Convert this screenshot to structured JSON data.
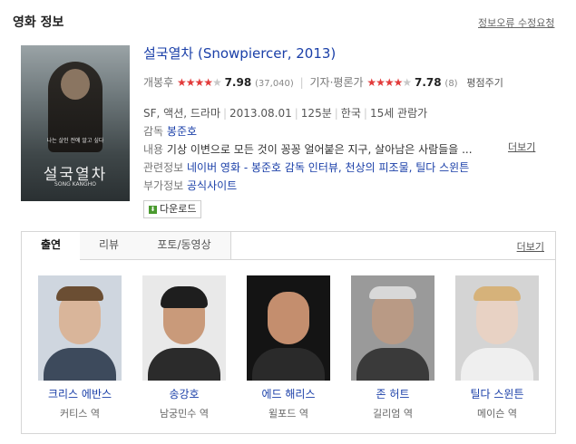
{
  "header": {
    "title": "영화 정보",
    "report_link": "정보오류 수정요청"
  },
  "poster": {
    "tagline": "나는 살인 전에 알고 싶다",
    "title": "설국열차",
    "subtitle": "SONG KANGHO"
  },
  "movie": {
    "title": "설국열차 (Snowpiercer, 2013)",
    "audience": {
      "label": "개봉후",
      "stars_filled": 4,
      "stars_total": 5,
      "score": "7.98",
      "count": "(37,040)"
    },
    "critic": {
      "label": "기자·평론가",
      "stars_filled": 4,
      "stars_total": 5,
      "score": "7.78",
      "count": "(8)",
      "link": "평점주기"
    },
    "meta": {
      "genre": "SF, 액션, 드라마",
      "date": "2013.08.01",
      "runtime": "125분",
      "country": "한국",
      "rating": "15세 관람가"
    },
    "director": {
      "label": "감독",
      "name": "봉준호"
    },
    "synopsis": {
      "label": "내용",
      "text": "기상 이변으로 모든 것이 꽁꽁 얼어붙은 지구, 살아남은 사람들을 ...",
      "more": "더보기"
    },
    "related": {
      "label": "관련정보",
      "text": "네이버 영화 - 봉준호 감독 인터뷰, 천상의 피조물, 틸다 스윈튼"
    },
    "extra": {
      "label": "부가정보",
      "text": "공식사이트"
    },
    "download": "다운로드"
  },
  "tabs": [
    "출연",
    "리뷰",
    "포토/동영상"
  ],
  "tabs_more": "더보기",
  "cast": [
    {
      "name": "크리스 에반스",
      "role": "커티스 역"
    },
    {
      "name": "송강호",
      "role": "남궁민수 역"
    },
    {
      "name": "에드 해리스",
      "role": "윌포드 역"
    },
    {
      "name": "존 허트",
      "role": "길리엄 역"
    },
    {
      "name": "틸다 스윈튼",
      "role": "메이슨 역"
    }
  ],
  "colors": {
    "link": "#1a3fa8",
    "star": "#e23b3b",
    "download": "#4a9a2e"
  }
}
